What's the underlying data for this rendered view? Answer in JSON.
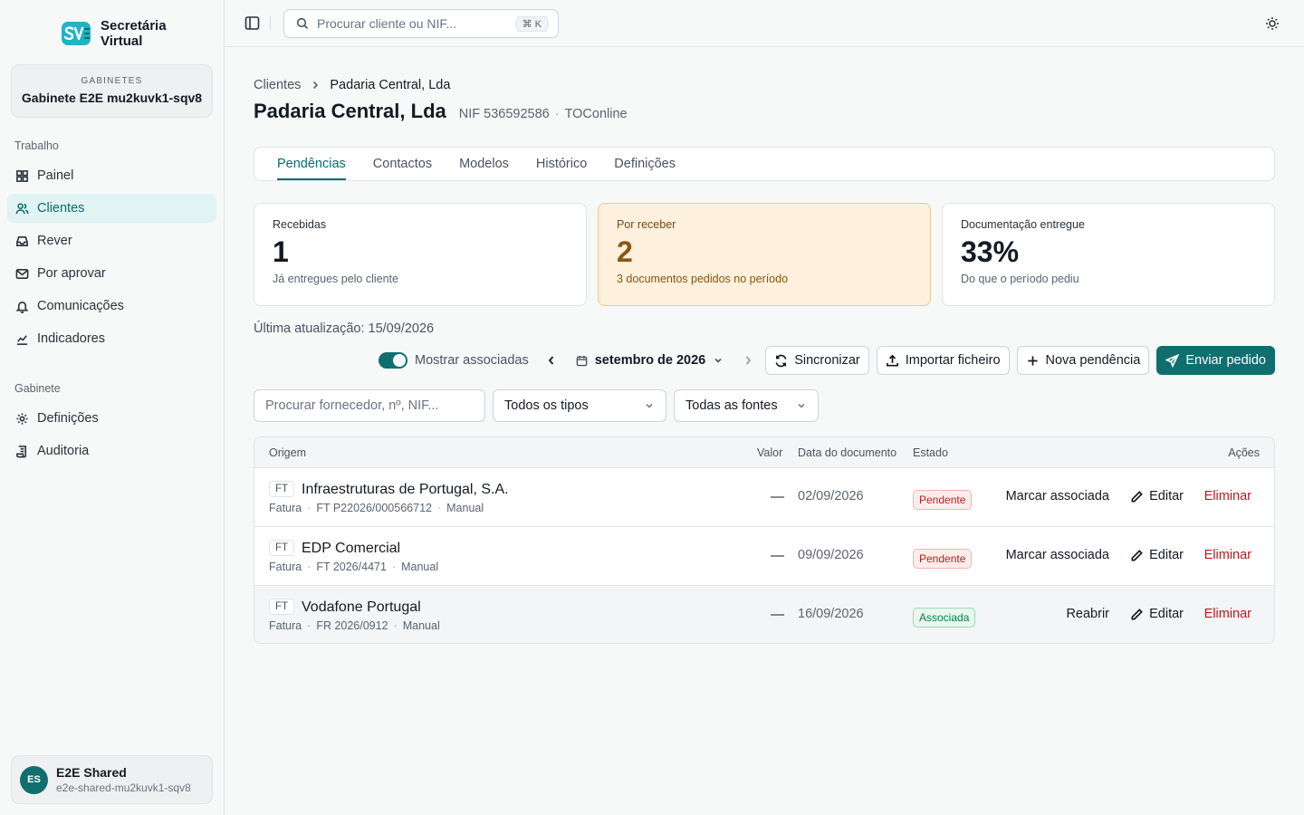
{
  "brand": {
    "line1": "Secretária",
    "line2": "Virtual",
    "logo_icon": "sv-logo-icon"
  },
  "office": {
    "label": "GABINETES",
    "name": "Gabinete E2E mu2kuvk1-sqv8"
  },
  "sidebar": {
    "section_work": "Trabalho",
    "work_items": [
      {
        "label": "Painel",
        "icon": "grid-icon"
      },
      {
        "label": "Clientes",
        "icon": "users-icon",
        "active": true
      },
      {
        "label": "Rever",
        "icon": "inbox-icon"
      },
      {
        "label": "Por aprovar",
        "icon": "mail-icon"
      },
      {
        "label": "Comunicações",
        "icon": "bell-icon"
      },
      {
        "label": "Indicadores",
        "icon": "chart-icon"
      }
    ],
    "section_office": "Gabinete",
    "office_items": [
      {
        "label": "Definições",
        "icon": "gear-icon"
      },
      {
        "label": "Auditoria",
        "icon": "scroll-icon"
      }
    ]
  },
  "user": {
    "initials": "ES",
    "name": "E2E Shared",
    "email": "e2e-shared-mu2kuvk1-sqv8"
  },
  "topbar": {
    "search_placeholder": "Procurar cliente ou NIF...",
    "shortcut": "⌘ K"
  },
  "breadcrumb": {
    "parent": "Clientes",
    "current": "Padaria Central, Lda"
  },
  "client": {
    "name": "Padaria Central, Lda",
    "nif": "NIF 536592586",
    "source": "TOConline"
  },
  "tabs": [
    "Pendências",
    "Contactos",
    "Modelos",
    "Histórico",
    "Definições"
  ],
  "stats": [
    {
      "label": "Recebidas",
      "value": "1",
      "sub": "Já entregues pelo cliente"
    },
    {
      "label": "Por receber",
      "value": "2",
      "sub": "3 documentos pedidos no período"
    },
    {
      "label": "Documentação entregue",
      "value": "33%",
      "sub": "Do que o período pediu"
    }
  ],
  "updated": "Última atualização: 15/09/2026",
  "toolbar": {
    "toggle_label": "Mostrar associadas",
    "month": "setembro de 2026",
    "sync": "Sincronizar",
    "import": "Importar ficheiro",
    "new": "Nova pendência",
    "send": "Enviar pedido"
  },
  "filters": {
    "search_placeholder": "Procurar fornecedor, nº, NIF...",
    "type": "Todos os tipos",
    "source": "Todas as fontes"
  },
  "table": {
    "headers": {
      "origin": "Origem",
      "value": "Valor",
      "date": "Data do documento",
      "status": "Estado",
      "actions": "Ações"
    },
    "rows": [
      {
        "kind": "FT",
        "origin": "Infraestruturas de Portugal, S.A.",
        "doc_type": "Fatura",
        "doc_no": "FT P22026/000566712",
        "channel": "Manual",
        "value": "—",
        "date": "02/09/2026",
        "status": "Pendente",
        "primary_action": "Marcar associada",
        "edit": "Editar",
        "delete": "Eliminar"
      },
      {
        "kind": "FT",
        "origin": "EDP Comercial",
        "doc_type": "Fatura",
        "doc_no": "FT 2026/4471",
        "channel": "Manual",
        "value": "—",
        "date": "09/09/2026",
        "status": "Pendente",
        "primary_action": "Marcar associada",
        "edit": "Editar",
        "delete": "Eliminar"
      },
      {
        "kind": "FT",
        "origin": "Vodafone Portugal",
        "doc_type": "Fatura",
        "doc_no": "FR 2026/0912",
        "channel": "Manual",
        "value": "—",
        "date": "16/09/2026",
        "status": "Associada",
        "primary_action": "Reabrir",
        "edit": "Editar",
        "delete": "Eliminar"
      }
    ]
  },
  "colors": {
    "accent": "#0f6f6f",
    "warn_bg": "#fdf0dc",
    "danger": "#c4151c"
  }
}
